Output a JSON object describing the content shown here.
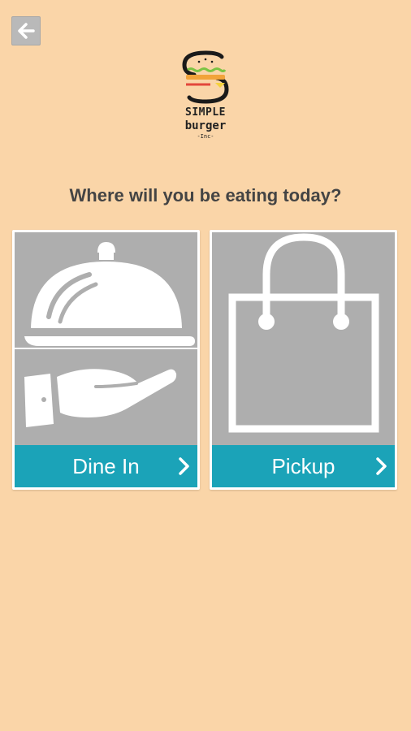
{
  "header": {
    "back_icon": "arrow-left-icon"
  },
  "logo": {
    "line1": "SIMPLE",
    "line2": "burger",
    "line3": "-Inc-"
  },
  "prompt": {
    "question": "Where will you be eating today?"
  },
  "options": [
    {
      "label": "Dine In",
      "icon": "cloche-serving-hand-icon",
      "chevron": "chevron-right-icon"
    },
    {
      "label": "Pickup",
      "icon": "shopping-bag-icon",
      "chevron": "chevron-right-icon"
    }
  ],
  "colors": {
    "background": "#fad5a8",
    "card_image": "#aeaeae",
    "accent": "#1ba3b8",
    "back_button": "#b9b9b9"
  }
}
